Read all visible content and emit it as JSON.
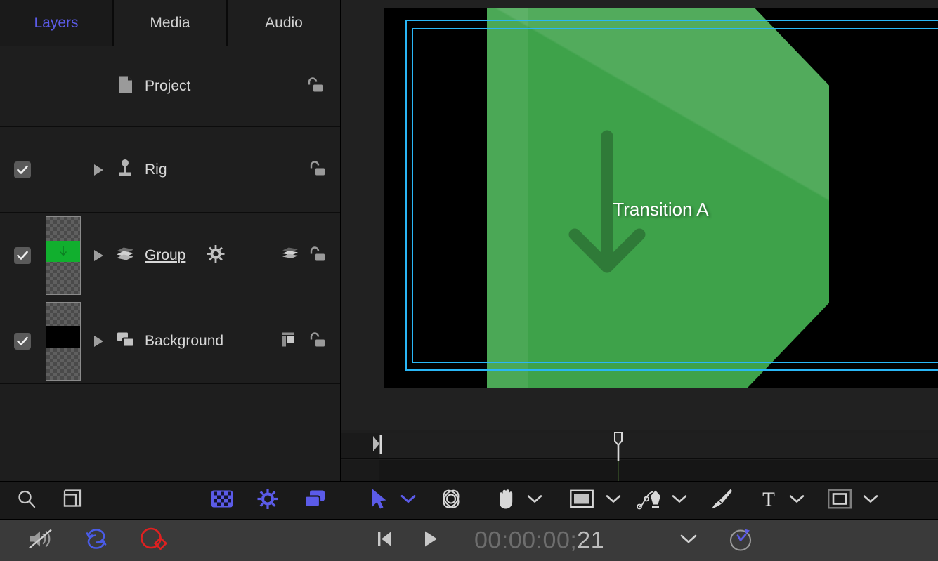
{
  "app": {
    "accent_blue": "#5b5be8",
    "accent_cyan": "#29b6f6",
    "accent_red": "#e02020",
    "green_shape": "#3ea24a",
    "green_arrow": "#2f7a38"
  },
  "tabs": [
    {
      "label": "Layers",
      "active": true
    },
    {
      "label": "Media",
      "active": false
    },
    {
      "label": "Audio",
      "active": false
    }
  ],
  "layers": {
    "project": {
      "name": "Project",
      "icon": "document-icon",
      "lock": "unlocked-padlock-icon"
    },
    "rows": [
      {
        "name": "Rig",
        "icon": "rig-icon",
        "checked": true,
        "has_thumbnail": false,
        "underlined": false,
        "gear": false,
        "right_icons": [
          "unlocked-padlock-icon"
        ]
      },
      {
        "name": "Group",
        "icon": "group-layers-icon",
        "checked": true,
        "has_thumbnail": true,
        "thumbnail_band_color": "#11af2e",
        "underlined": true,
        "gear": true,
        "right_icons": [
          "layer-stack-icon",
          "unlocked-padlock-icon"
        ]
      },
      {
        "name": "Background",
        "icon": "shapes-icon",
        "checked": true,
        "has_thumbnail": true,
        "thumbnail_band_color": "#000000",
        "underlined": false,
        "gear": false,
        "right_icons": [
          "align-layout-icon",
          "unlocked-padlock-icon"
        ]
      }
    ]
  },
  "left_toolbar": {
    "items": [
      {
        "name": "search-icon",
        "color": "#c8c8c8"
      },
      {
        "name": "frame-icon",
        "color": "#c8c8c8"
      },
      {
        "name": "checkerboard-icon",
        "color": "#5b5be8"
      },
      {
        "name": "gear-icon",
        "color": "#5b5be8"
      },
      {
        "name": "duplicate-layers-icon",
        "color": "#5b5be8"
      }
    ]
  },
  "tool_bar": {
    "tools": [
      {
        "name": "selection-arrow-tool",
        "has_chevron": true,
        "active": true
      },
      {
        "name": "orbit-3d-tool",
        "has_chevron": false,
        "active": false
      },
      {
        "name": "hand-tool",
        "has_chevron": true,
        "active": false
      },
      {
        "name": "rectangle-shape-tool",
        "has_chevron": true,
        "active": false
      },
      {
        "name": "pen-tool",
        "has_chevron": true,
        "active": false
      },
      {
        "name": "paintbrush-tool",
        "has_chevron": false,
        "active": false
      },
      {
        "name": "text-tool",
        "has_chevron": true,
        "active": false
      },
      {
        "name": "mask-tool",
        "has_chevron": true,
        "active": false
      }
    ]
  },
  "transport": {
    "mute_icon": "muted-speaker-icon",
    "loop_icon": "loop-icon",
    "record_icon": "record-keyframe-icon",
    "prev_frame_icon": "skip-to-start-icon",
    "play_icon": "play-icon",
    "timecode_dim": "00:00:00;",
    "timecode_frames": "21",
    "timecode_chevron": "chevron-down-icon",
    "retime_icon": "retime-clock-icon"
  },
  "viewer": {
    "label": "Transition A",
    "arrow_direction": "down",
    "guides": [
      "title-safe-guide",
      "action-safe-guide"
    ]
  },
  "timeline": {
    "in_point_marker": "in-point-marker",
    "playhead": "playhead-marker"
  }
}
